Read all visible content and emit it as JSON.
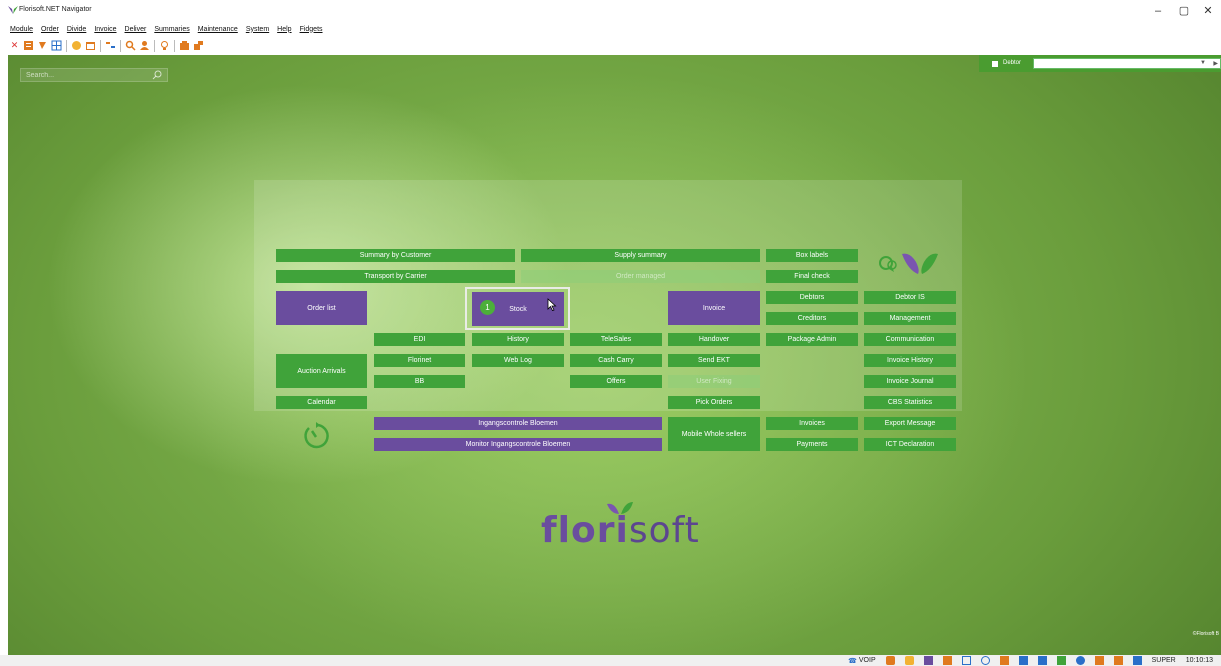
{
  "window": {
    "title": "Florisoft.NET Navigator",
    "minimize_glyph": "–",
    "maximize_glyph": "▢",
    "close_glyph": "✕"
  },
  "menu": [
    "Module",
    "Order",
    "Divide",
    "Invoice",
    "Deliver",
    "Summaries",
    "Maintenance",
    "System",
    "Help",
    "Fidgets"
  ],
  "search": {
    "placeholder": "Search..."
  },
  "debtor": {
    "label": "Debtor",
    "value": "",
    "checked": true
  },
  "buttons": {
    "summary_by_customer": "Summary by Customer",
    "supply_summary": "Supply summary",
    "box_labels": "Box labels",
    "transport_by_carrier": "Transport by Carrier",
    "order_managed": "Order managed",
    "final_check": "Final check",
    "order_list": "Order list",
    "stock": "Stock",
    "stock_badge": "1",
    "invoice": "Invoice",
    "debtors": "Debtors",
    "debtor_is": "Debtor IS",
    "creditors": "Creditors",
    "management": "Management",
    "edi": "EDI",
    "history": "History",
    "telesales": "TeleSales",
    "handover": "Handover",
    "package_admin": "Package Admin",
    "communication": "Communication",
    "florinet": "Florinet",
    "web_log": "Web Log",
    "cash_carry": "Cash Carry",
    "send_ekt": "Send EKT",
    "invoice_history": "Invoice History",
    "auction_arrivals": "Auction Arrivals",
    "bb": "BB",
    "offers": "Offers",
    "user_fixing": "User Fixing",
    "invoice_journal": "Invoice Journal",
    "calendar": "Calendar",
    "pick_orders": "Pick Orders",
    "cbs_statistics": "CBS Statistics",
    "ingangscontrole": "Ingangscontrole Bloemen",
    "mobile_whole_sellers": "Mobile Whole sellers",
    "invoices": "Invoices",
    "export_message": "Export Message",
    "monitor_ingangscontrole": "Monitor Ingangscontrole Bloemen",
    "payments": "Payments",
    "ict_declaration": "ICT Declaration"
  },
  "brand": {
    "name_main": "flori",
    "name_soft": "soft",
    "copyright": "©Florisoft B"
  },
  "status": {
    "voip": "VOIP",
    "user": "SUPER",
    "time": "10:10:13"
  },
  "colors": {
    "green": "#40a33a",
    "purple": "#6a4d9e"
  }
}
